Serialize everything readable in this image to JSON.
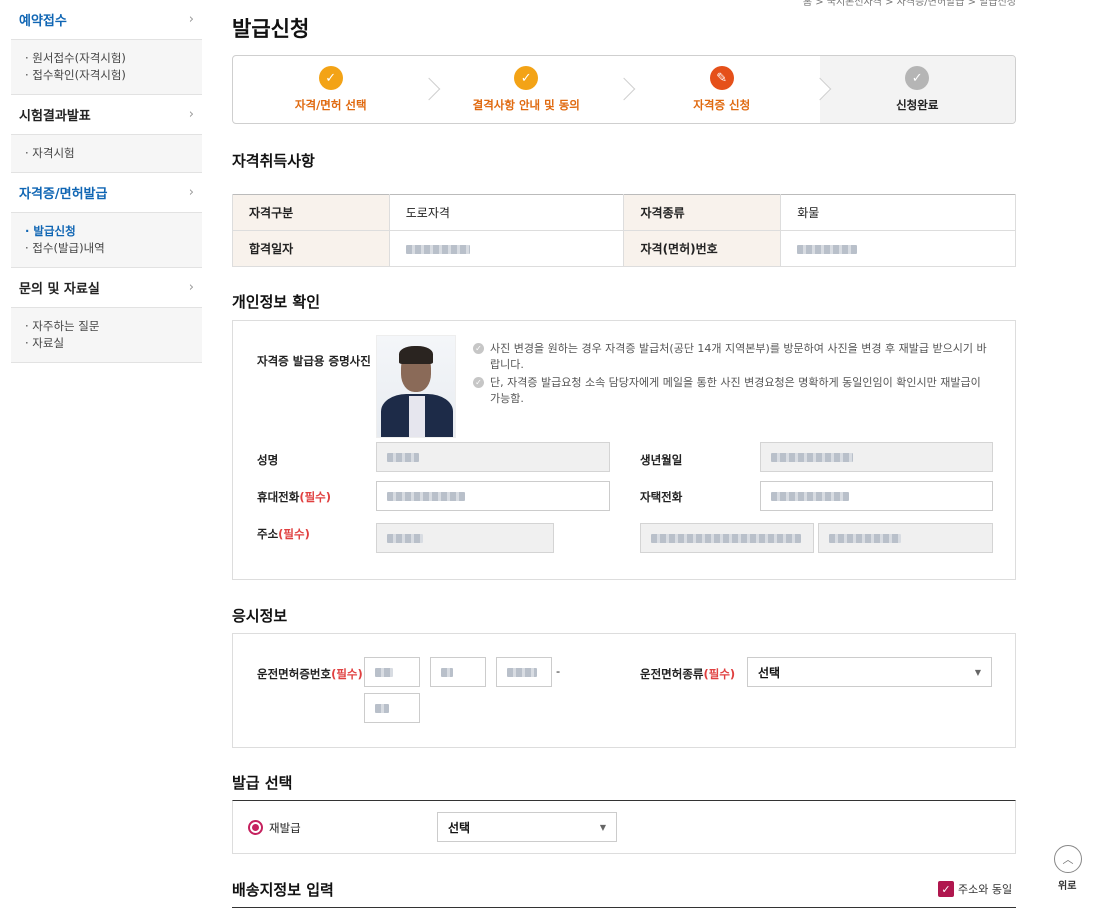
{
  "sidebar": {
    "sections": [
      {
        "title": "예약접수",
        "active": true,
        "items": [
          {
            "label": "· 원서접수(자격시험)"
          },
          {
            "label": "· 접수확인(자격시험)"
          }
        ]
      },
      {
        "title": "시험결과발표",
        "active": false,
        "items": [
          {
            "label": "· 자격시험"
          }
        ]
      },
      {
        "title": "자격증/면허발급",
        "active": true,
        "items": [
          {
            "label": "· 발급신청"
          },
          {
            "label": "· 접수(발급)내역"
          }
        ]
      },
      {
        "title": "문의 및 자료실",
        "active": false,
        "items": [
          {
            "label": "· 자주하는 질문"
          },
          {
            "label": "· 자료실"
          }
        ]
      }
    ]
  },
  "page": {
    "title": "발급신청",
    "breadcrumb": "홈 > 국지본선자격 > 자격증/면허발급 > 발급신청"
  },
  "steps": [
    {
      "label": "자격/면허 선택",
      "icon": "check-icon",
      "status": "done"
    },
    {
      "label": "결격사항 안내 및 동의",
      "icon": "check-icon",
      "status": "done"
    },
    {
      "label": "자격증 신청",
      "icon": "pencil-icon",
      "status": "current"
    },
    {
      "label": "신청완료",
      "icon": "check-icon",
      "status": "pending"
    }
  ],
  "qualification": {
    "title": "자격취득사항",
    "type_label": "자격구분",
    "type_value": "도로자격",
    "kind_label": "자격종류",
    "kind_value": "화물",
    "date_label": "합격일자",
    "number_label": "자격(면허)번호"
  },
  "personal": {
    "title": "개인정보 확인",
    "photo_label": "자격증 발급용 증명사진",
    "notes": [
      "사진 변경을 원하는 경우 자격증 발급처(공단 14개 지역본부)를 방문하여 사진을 변경 후 재발급 받으시기 바랍니다.",
      "단, 자격증 발급요청 소속 담당자에게 메일을 통한 사진 변경요청은 명확하게 동일인임이 확인시만 재발급이 가능함."
    ],
    "name_label": "성명",
    "birth_label": "생년월일",
    "mobile_label": "휴대전화",
    "home_phone_label": "자택전화",
    "address_label": "주소",
    "required_mark": "(필수)"
  },
  "exam": {
    "title": "응시정보",
    "license_number_label": "운전면허증번호",
    "license_type_label": "운전면허종류",
    "license_type_value": "선택",
    "dash": "-",
    "required_mark": "(필수)"
  },
  "issue": {
    "title": "발급 선택",
    "option_label": "재발급",
    "select_value": "선택"
  },
  "delivery": {
    "title": "배송지정보 입력",
    "same_address_label": "주소와 동일"
  },
  "top_button": {
    "label": "위로"
  },
  "colors": {
    "accent_blue": "#1066b4",
    "step_orange": "#f3a316",
    "step_red": "#e5501a",
    "radio_magenta": "#c5215e",
    "required_red": "#e04040"
  }
}
